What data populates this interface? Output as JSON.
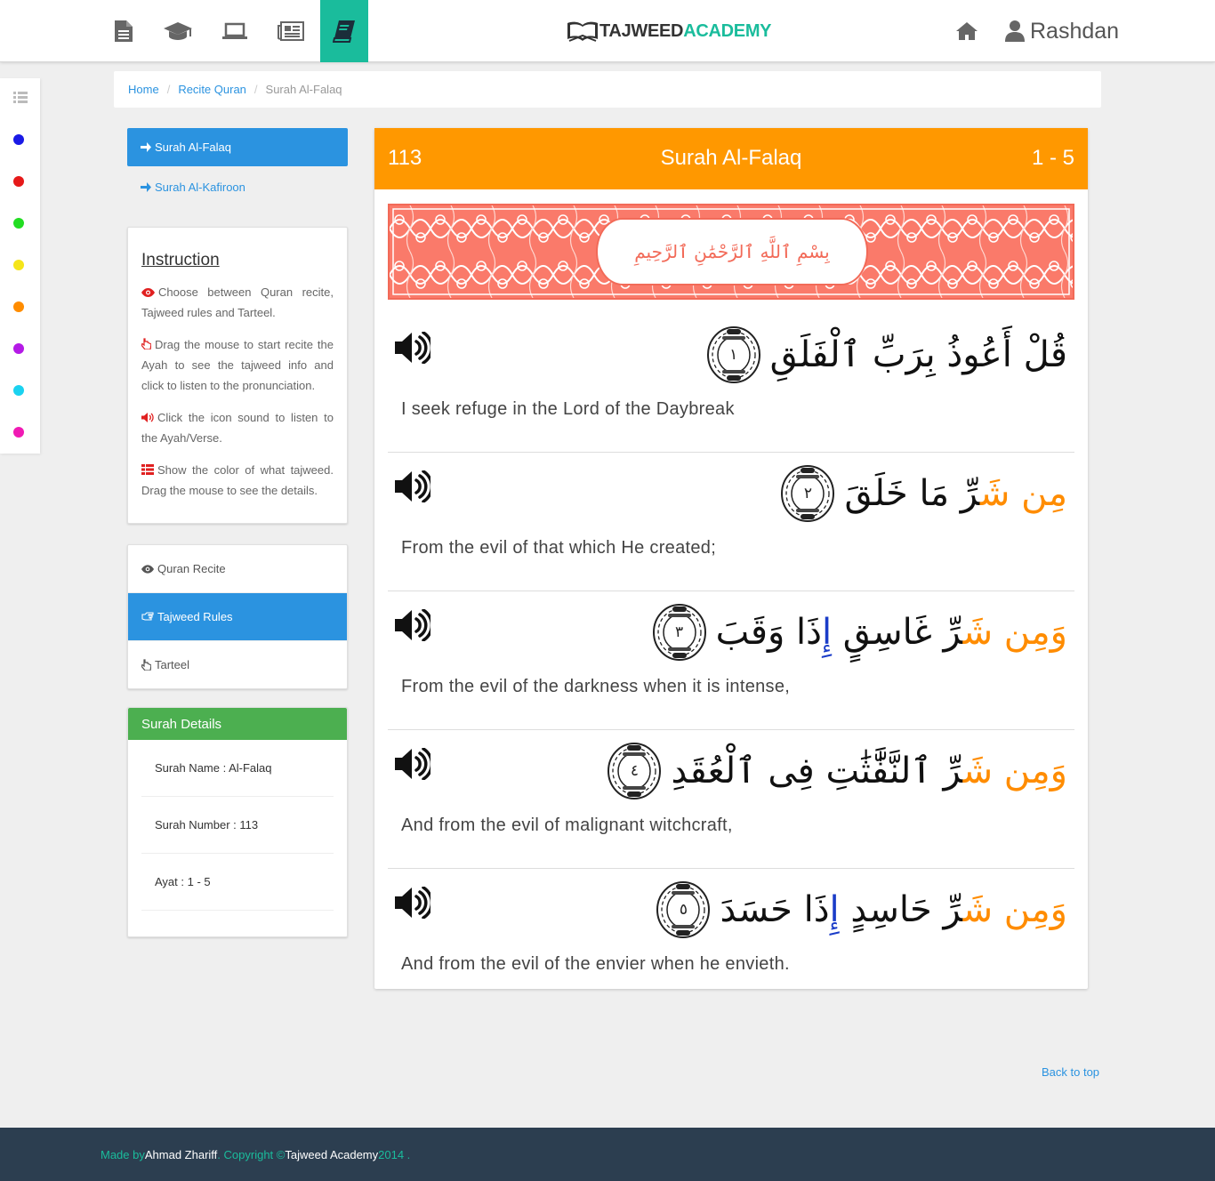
{
  "brand": {
    "part1": "TAJWEED",
    "part2": "ACADEMY"
  },
  "nav": {
    "icons": [
      "document-icon",
      "graduation-cap-icon",
      "laptop-icon",
      "newspaper-icon",
      "book-icon"
    ],
    "active_index": 4
  },
  "user": {
    "name": "Rashdan"
  },
  "tajweed_colors": [
    "#1a1ae6",
    "#e61919",
    "#22dd22",
    "#f5e51a",
    "#ff8c00",
    "#b41ae6",
    "#1ad2f0",
    "#f01ab4"
  ],
  "breadcrumb": {
    "home": "Home",
    "recite": "Recite Quran",
    "current": "Surah Al-Falaq"
  },
  "surah_links": [
    {
      "label": "Surah Al-Falaq",
      "active": true
    },
    {
      "label": "Surah Al-Kafiroon",
      "active": false
    }
  ],
  "instruction": {
    "title": "Instruction",
    "items": [
      "Choose between Quran recite, Tajweed rules and Tarteel.",
      "Drag the mouse to start recite the Ayah to see the tajweed info and click to listen to the pronunciation.",
      "Click the icon sound to listen to the Ayah/Verse.",
      "Show the color of what tajweed. Drag the mouse to see the details."
    ]
  },
  "modes": [
    {
      "label": "Quran Recite",
      "active": false
    },
    {
      "label": "Tajweed Rules",
      "active": true
    },
    {
      "label": "Tarteel",
      "active": false
    }
  ],
  "details": {
    "title": "Surah Details",
    "name": "Surah Name : Al-Falaq",
    "number": "Surah Number : 113",
    "ayat": "Ayat : 1 - 5"
  },
  "card": {
    "number": "113",
    "title": "Surah Al-Falaq",
    "range": "1 - 5",
    "bismillah": "بِسْمِ ٱللَّهِ ٱلرَّحْمَٰنِ ٱلرَّحِيمِ"
  },
  "ayat": [
    {
      "num": "١",
      "segments": [
        {
          "t": "قُلْ أَعُوذُ بِرَبِّ ٱلْفَلَقِ",
          "c": ""
        }
      ],
      "translation": "I seek refuge in the Lord of the Daybreak"
    },
    {
      "num": "٢",
      "segments": [
        {
          "t": "مِن",
          "c": "orange"
        },
        {
          "t": " شَ",
          "c": "orange"
        },
        {
          "t": "رِّ مَا خَلَقَ",
          "c": ""
        }
      ],
      "translation": "From the evil of that which He created;"
    },
    {
      "num": "٣",
      "segments": [
        {
          "t": "وَمِن",
          "c": "orange"
        },
        {
          "t": " شَ",
          "c": "orange"
        },
        {
          "t": "رِّ غَاسِقٍ ",
          "c": ""
        },
        {
          "t": "إِ",
          "c": "blue"
        },
        {
          "t": "ذَا وَقَبَ",
          "c": ""
        }
      ],
      "translation": "From the evil of the darkness when it is intense,"
    },
    {
      "num": "٤",
      "segments": [
        {
          "t": "وَمِن",
          "c": "orange"
        },
        {
          "t": " شَ",
          "c": "orange"
        },
        {
          "t": "رِّ ٱلنَّفَّٰثَٰتِ فِى ٱلْعُقَدِ",
          "c": ""
        }
      ],
      "translation": "And from the evil of malignant witchcraft,"
    },
    {
      "num": "٥",
      "segments": [
        {
          "t": "وَمِن",
          "c": "orange"
        },
        {
          "t": " شَ",
          "c": "orange"
        },
        {
          "t": "رِّ حَاسِدٍ ",
          "c": ""
        },
        {
          "t": "إِ",
          "c": "blue"
        },
        {
          "t": "ذَا حَسَدَ",
          "c": ""
        }
      ],
      "translation": "And from the evil of the envier when he envieth."
    }
  ],
  "back_to_top": "Back to top",
  "footer": {
    "made_by": "Made by ",
    "author": "Ahmad Zhariff",
    "copyright": ". Copyright © ",
    "org": "Tajweed Academy",
    "year": " 2014 ."
  }
}
